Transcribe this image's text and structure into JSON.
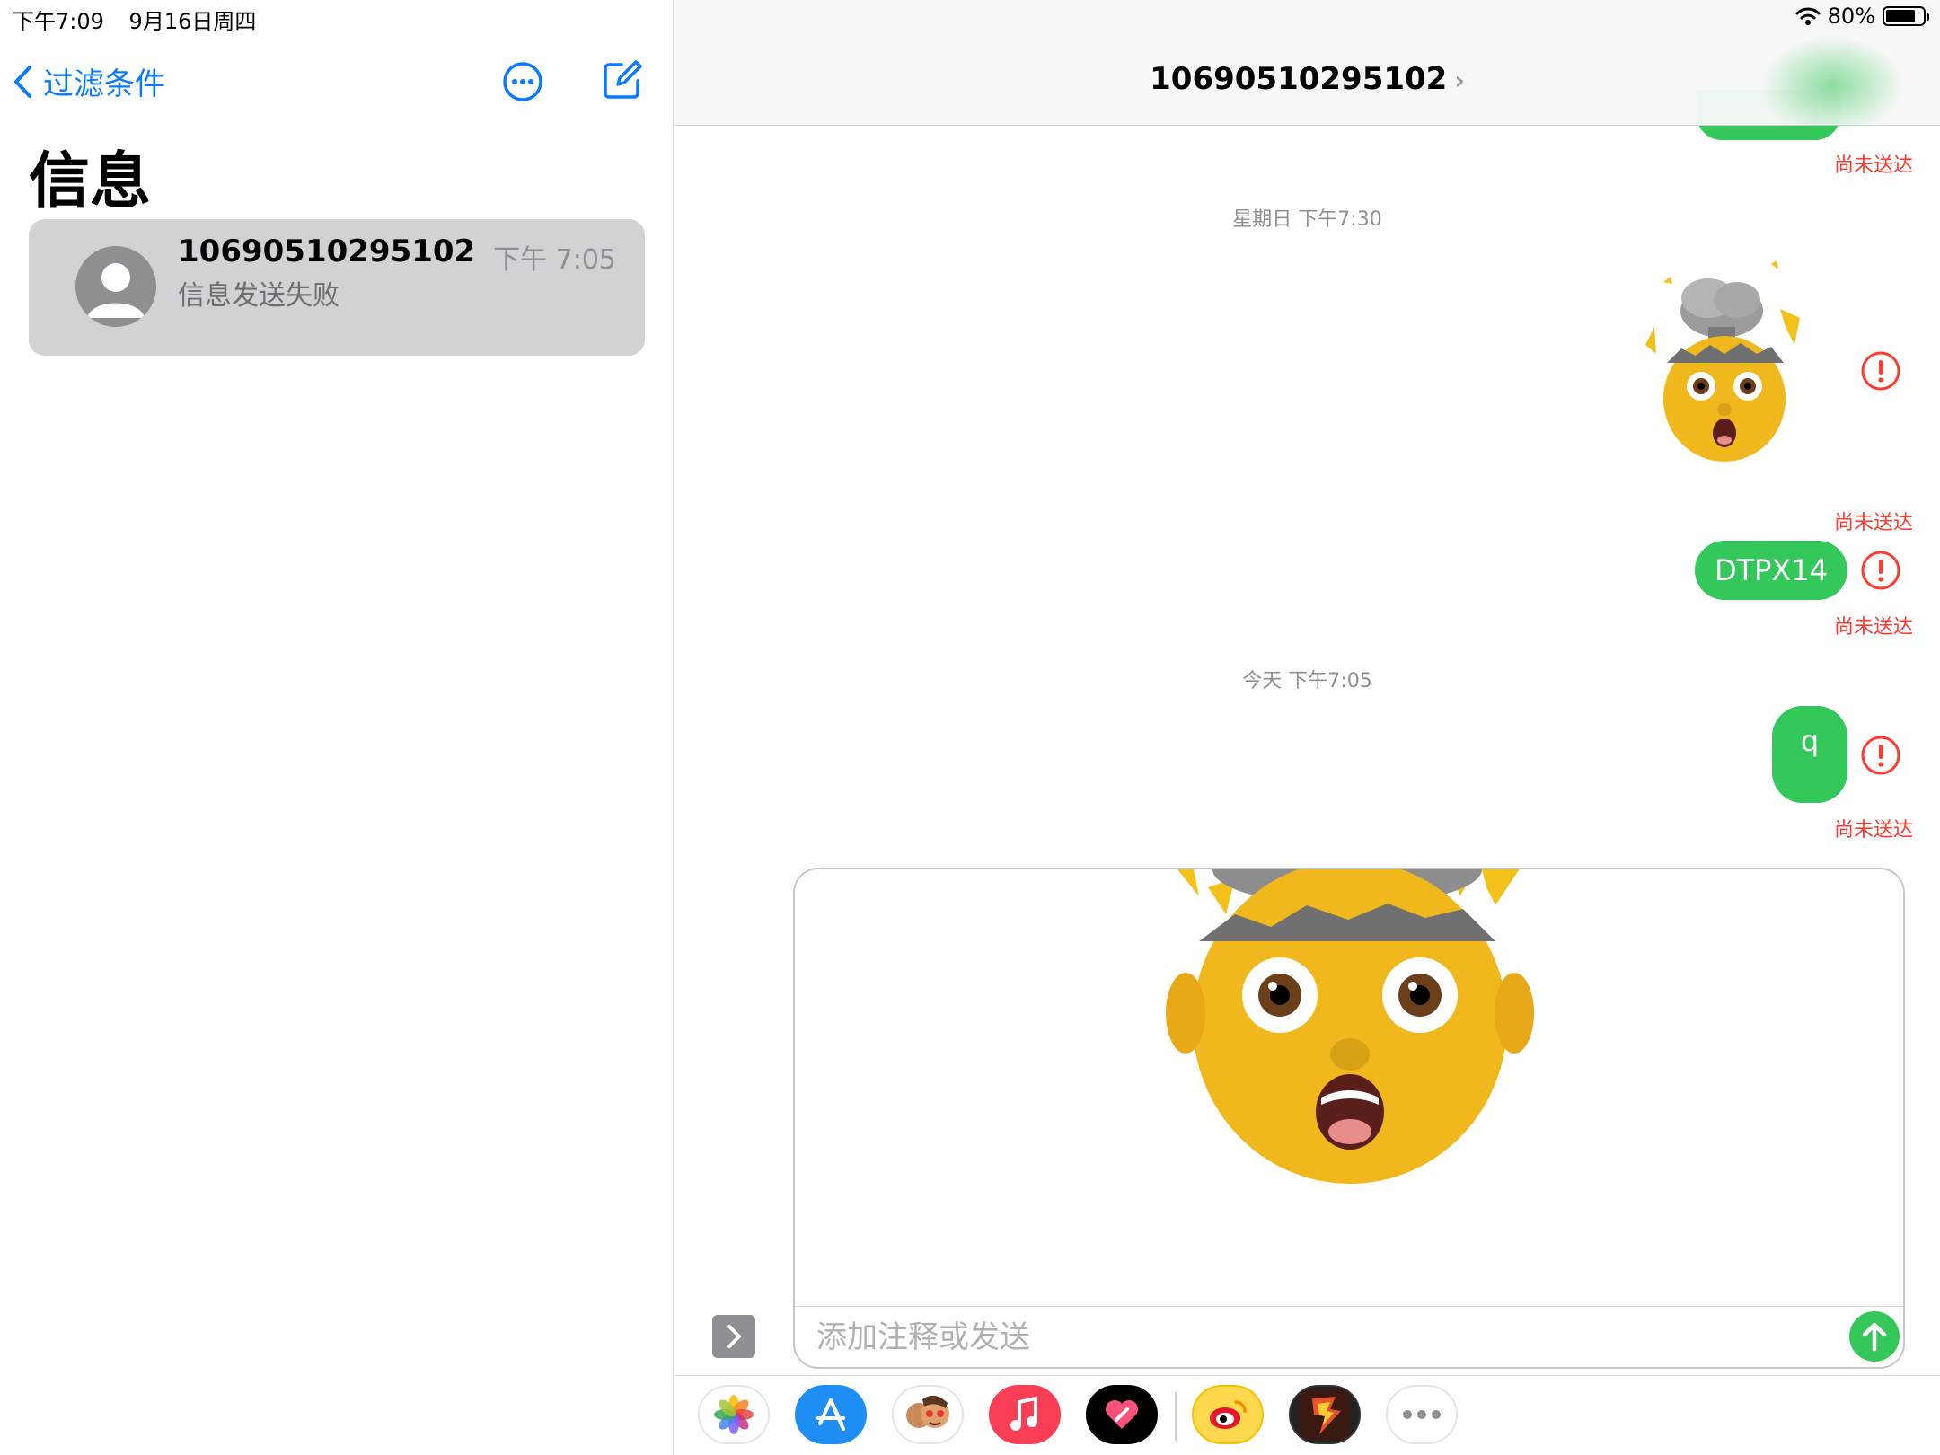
{
  "status_bar": {
    "time": "下午7:09",
    "date": "9月16日周四",
    "battery": "80%",
    "battery_level": 0.8
  },
  "sidebar": {
    "back_label": "过滤条件",
    "title": "信息",
    "conversations": [
      {
        "name": "10690510295102",
        "time": "下午 7:05",
        "preview": "信息发送失败"
      }
    ]
  },
  "chat": {
    "title": "10690510295102",
    "chevron": "›",
    "not_sent_label": "尚未送达",
    "timestamps": [
      "星期日 下午7:30",
      "今天 下午7:05"
    ],
    "messages": [
      {
        "type": "memoji",
        "icon": "exploding-head-memoji"
      },
      {
        "type": "text",
        "text": "DTPX14"
      },
      {
        "type": "text",
        "text": "q"
      }
    ]
  },
  "compose": {
    "placeholder": "添加注释或发送",
    "attachment": "exploding-head-memoji"
  },
  "app_drawer": {
    "apps": [
      "photos",
      "app-store",
      "memoji",
      "music",
      "digital-touch",
      "weibo",
      "game",
      "more"
    ]
  },
  "colors": {
    "accent": "#0a7aff",
    "bubble": "#34c759",
    "error": "#ff3b30",
    "selection": "#d1d1d6"
  }
}
